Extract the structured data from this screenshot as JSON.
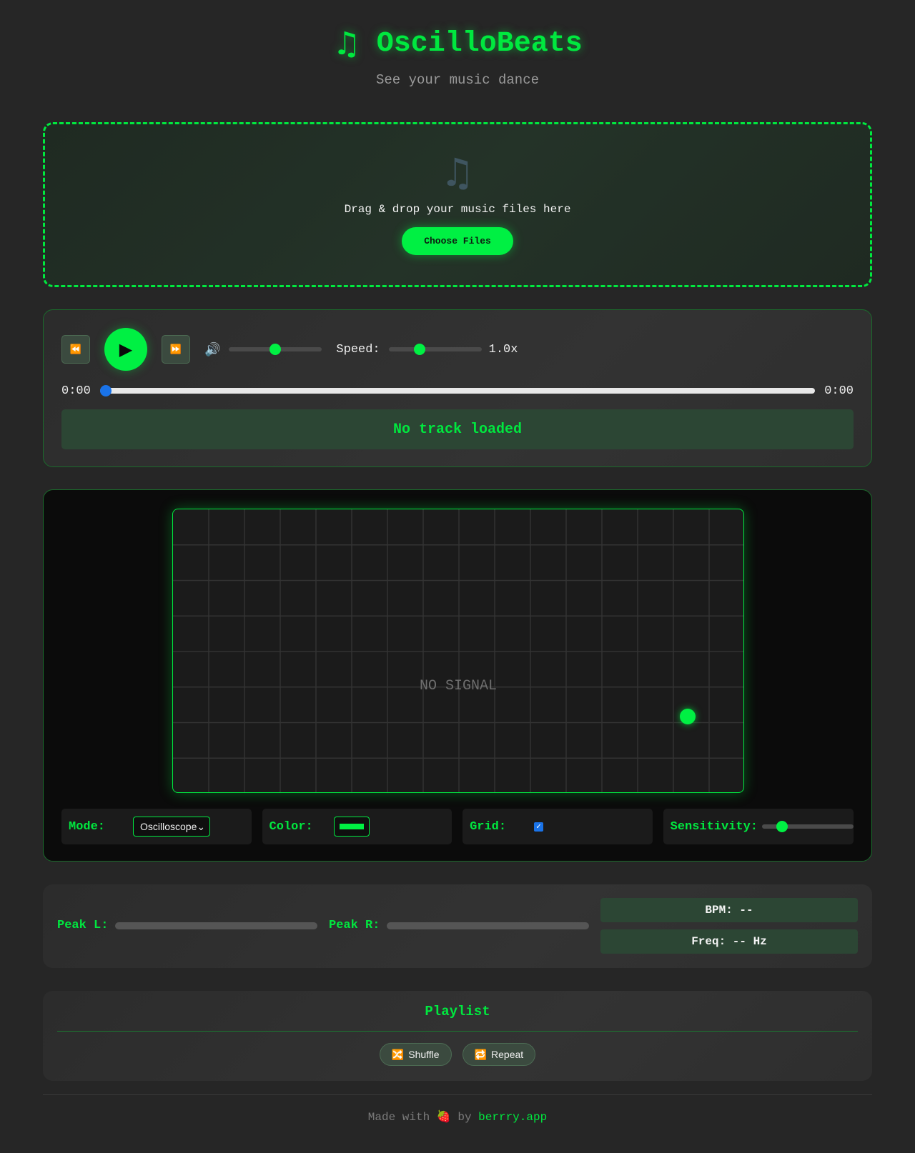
{
  "header": {
    "title": "OscilloBeats",
    "subtitle": "See your music dance",
    "icon": "music-note-icon"
  },
  "dropzone": {
    "icon": "music-note-icon",
    "text": "Drag & drop your music files here",
    "button_label": "Choose Files"
  },
  "player": {
    "rewind_icon": "⏪",
    "play_icon": "▶",
    "forward_icon": "⏩",
    "volume_icon": "🔊",
    "volume_level": 0.5,
    "speed_label": "Speed:",
    "speed_value": "1.0x",
    "speed_level": 0.33,
    "time_current": "0:00",
    "time_total": "0:00",
    "progress": 0,
    "now_playing": "No track loaded"
  },
  "scope": {
    "status": "NO SIGNAL",
    "accent_color": "#00f043",
    "options": {
      "mode_label": "Mode:",
      "mode_value": "Oscilloscope",
      "color_label": "Color:",
      "color_value": "#00f043",
      "grid_label": "Grid:",
      "grid_checked": true,
      "sensitivity_label": "Sensitivity:",
      "sensitivity_level": 0.22
    }
  },
  "stats": {
    "peak_left_label": "Peak L:",
    "peak_right_label": "Peak R:",
    "bpm": "BPM: --",
    "freq": "Freq: -- Hz"
  },
  "playlist": {
    "title": "Playlist",
    "shuffle_icon": "🔀",
    "shuffle_label": "Shuffle",
    "repeat_icon": "🔁",
    "repeat_label": "Repeat"
  },
  "footer": {
    "prefix": "Made with",
    "heart": "🍓",
    "by": "by",
    "brand": "berrry.app"
  }
}
